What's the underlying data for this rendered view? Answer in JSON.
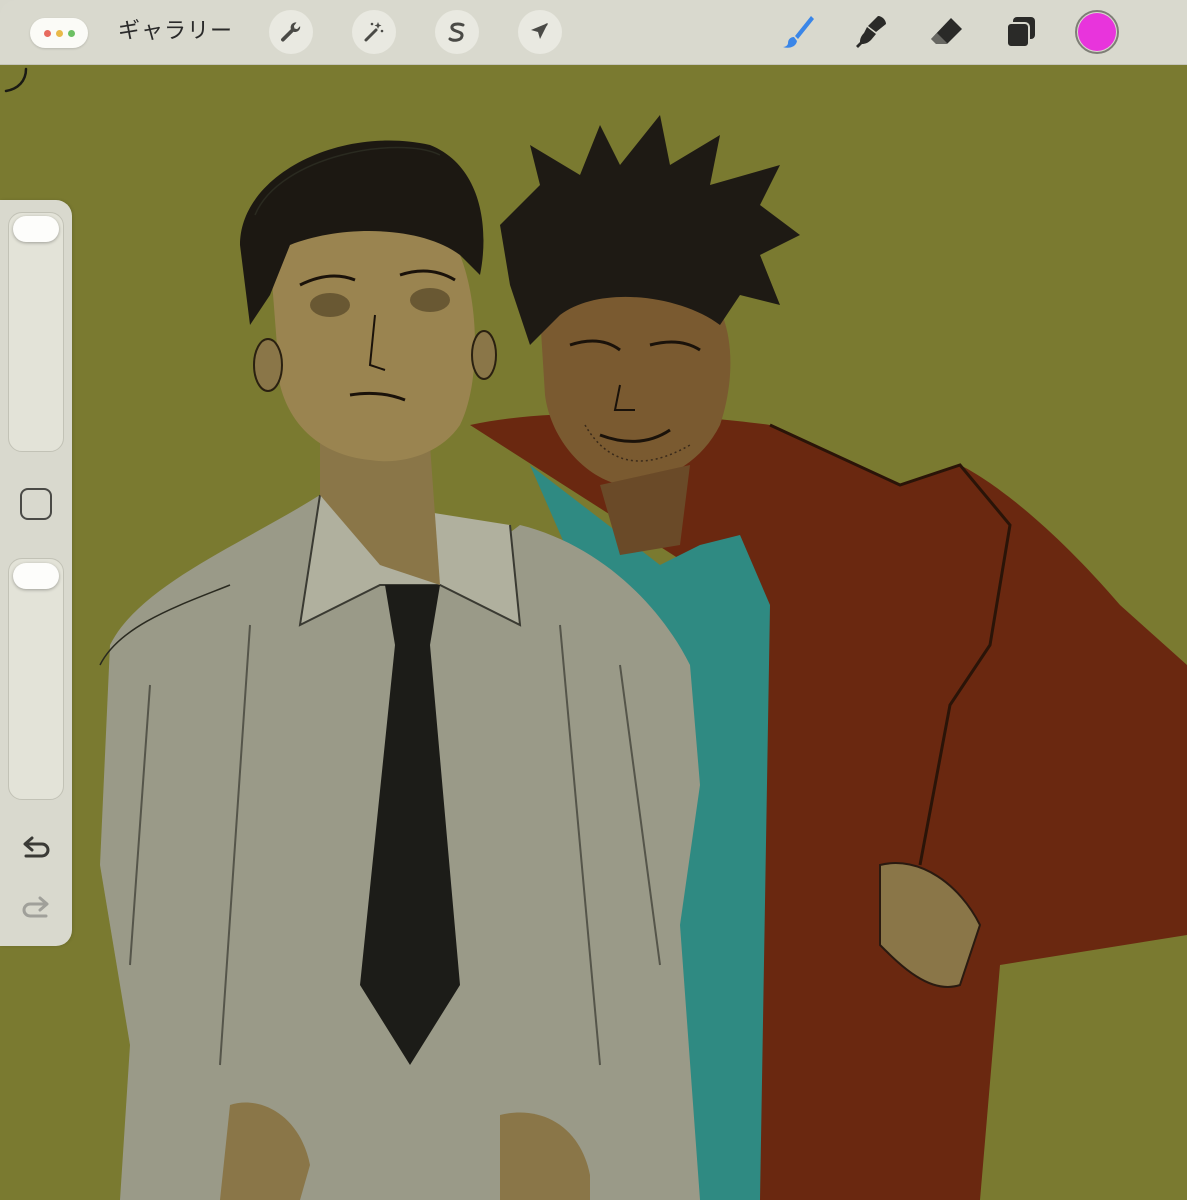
{
  "toolbar": {
    "gallery_label": "ギャラリー",
    "window_dots": [
      "#e76a5e",
      "#e9b949",
      "#6cc063"
    ],
    "actions": [
      {
        "name": "actions",
        "icon": "wrench-icon"
      },
      {
        "name": "adjustments",
        "icon": "magic-wand-icon"
      },
      {
        "name": "selection",
        "icon": "selection-s-icon"
      },
      {
        "name": "transform",
        "icon": "arrow-cursor-icon"
      }
    ],
    "tools": [
      {
        "name": "brush",
        "icon": "brush-icon",
        "active": true,
        "active_color": "#3a86e8"
      },
      {
        "name": "smudge",
        "icon": "smudge-icon"
      },
      {
        "name": "eraser",
        "icon": "eraser-icon"
      },
      {
        "name": "layers",
        "icon": "layers-icon"
      }
    ],
    "current_color": "#e834dc"
  },
  "sidebar": {
    "brush_size_level": 1.0,
    "opacity_level": 1.0,
    "modify_button": "square-modify-icon",
    "undo_icon": "undo-icon",
    "redo_icon": "redo-icon"
  },
  "canvas": {
    "background_color": "#7a7a30"
  }
}
